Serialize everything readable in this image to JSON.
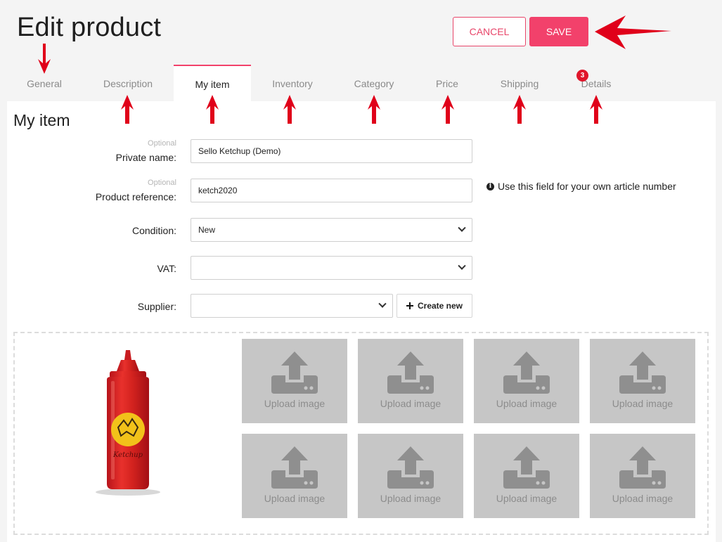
{
  "header": {
    "title": "Edit product",
    "cancel_label": "CANCEL",
    "save_label": "SAVE"
  },
  "tabs": [
    {
      "label": "General"
    },
    {
      "label": "Description"
    },
    {
      "label": "My item",
      "active": true
    },
    {
      "label": "Inventory"
    },
    {
      "label": "Category"
    },
    {
      "label": "Price"
    },
    {
      "label": "Shipping"
    },
    {
      "label": "Details",
      "badge": "3"
    }
  ],
  "section": {
    "title": "My item"
  },
  "form": {
    "optional_text": "Optional",
    "private_name": {
      "label": "Private name:",
      "value": "Sello Ketchup (Demo)"
    },
    "product_reference": {
      "label": "Product reference:",
      "value": "ketch2020",
      "hint": "Use this field for your own article number"
    },
    "condition": {
      "label": "Condition:",
      "value": "New"
    },
    "vat": {
      "label": "VAT:",
      "value": ""
    },
    "supplier": {
      "label": "Supplier:",
      "value": ""
    },
    "create_new_label": "Create new"
  },
  "images": {
    "product_image_text": "Ketchup",
    "upload_label": "Upload image",
    "upload_slots": 8
  },
  "colors": {
    "accent": "#f2416b",
    "annotation_arrow": "#e0001a",
    "upload_tile": "#c6c6c6"
  }
}
